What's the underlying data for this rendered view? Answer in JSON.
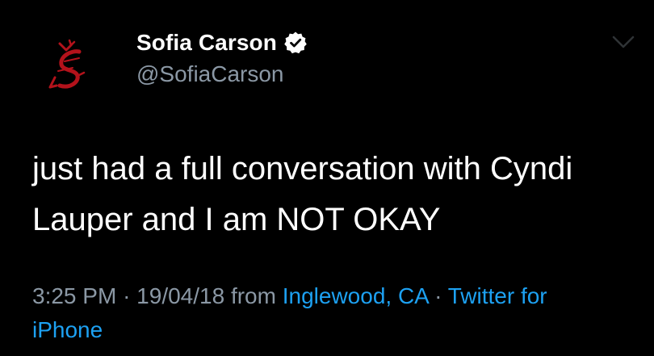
{
  "tweet": {
    "display_name": "Sofia Carson",
    "handle": "@SofiaCarson",
    "text_lines": [
      "just had a full conversation with Cyndi",
      "Lauper and I am NOT OKAY"
    ],
    "time": "3:25 PM",
    "separator": "·",
    "date": "19/04/18",
    "from_label": "from",
    "location": "Inglewood, CA",
    "source_part1": "Twitter for",
    "source_part2": "iPhone"
  },
  "colors": {
    "background": "#000000",
    "text": "#ffffff",
    "secondary": "#8b98a5",
    "link": "#1da1f2",
    "avatar_logo": "#b3121b"
  },
  "icons": {
    "verified": "verified-badge-icon",
    "menu": "chevron-down-icon",
    "avatar": "avatar-logo"
  }
}
